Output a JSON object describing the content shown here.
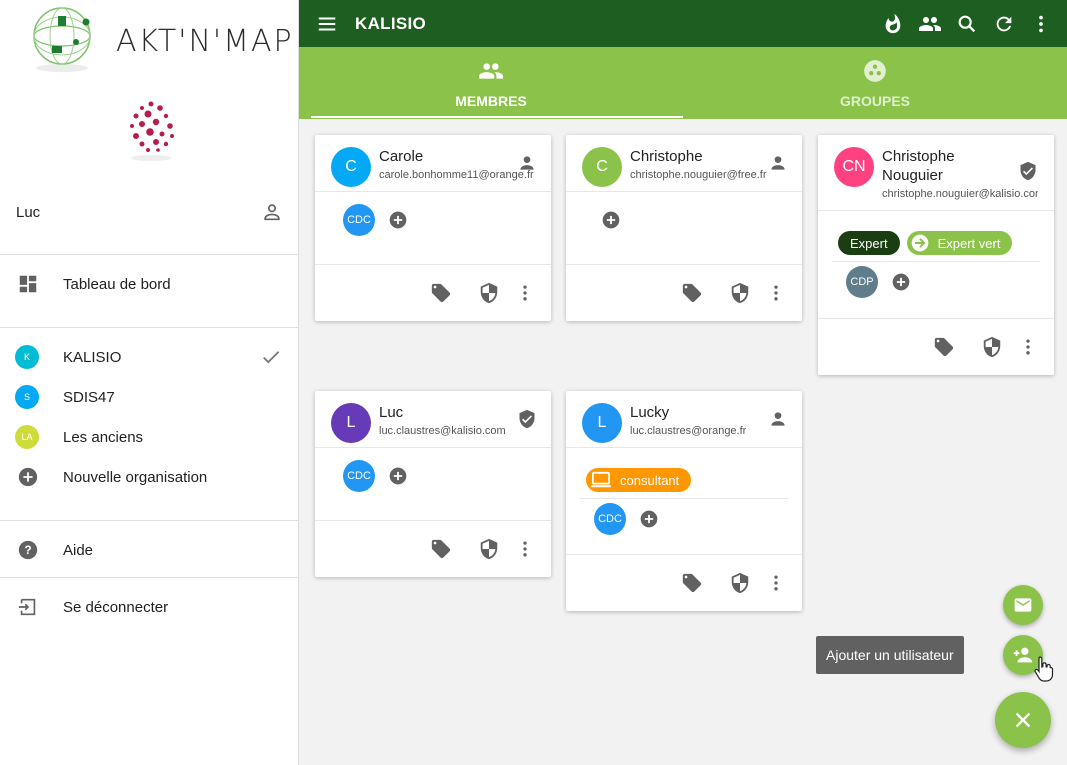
{
  "sidebar": {
    "app_name": "AKT'N'MAP",
    "user_name": "Luc",
    "dashboard_label": "Tableau de bord",
    "organisations": [
      {
        "label": "KALISIO",
        "initials": "K",
        "color": "#00bcd4",
        "selected": true
      },
      {
        "label": "SDIS47",
        "initials": "S",
        "color": "#03a9f4",
        "selected": false
      },
      {
        "label": "Les anciens",
        "initials": "LA",
        "color": "#cddc39",
        "selected": false
      }
    ],
    "new_org_label": "Nouvelle organisation",
    "help_label": "Aide",
    "logout_label": "Se déconnecter"
  },
  "topbar": {
    "title": "KALISIO",
    "icons": [
      "fire-icon",
      "people-icon",
      "search-icon",
      "refresh-icon",
      "more-vert-icon"
    ]
  },
  "tabs": [
    {
      "label": "MEMBRES",
      "icon": "people-icon",
      "active": true
    },
    {
      "label": "GROUPES",
      "icon": "bubbles-icon",
      "active": false
    }
  ],
  "members": [
    {
      "initials": "C",
      "name": "Carole",
      "email": "carole.bonhomme11@orange.fr",
      "color": "#03a9f4",
      "role": "member",
      "tags": [],
      "groups": [
        {
          "label": "CDC",
          "color": "#2196f3"
        }
      ]
    },
    {
      "initials": "C",
      "name": "Christophe",
      "email": "christophe.nouguier@free.fr",
      "color": "#8bc34a",
      "role": "member",
      "tags": [],
      "groups": []
    },
    {
      "initials": "CN",
      "name": "Christophe Nouguier",
      "email": "christophe.nouguier@kalisio.com",
      "color": "#ff4081",
      "role": "manager",
      "tags": [
        {
          "label": "Expert",
          "color": "#1b3d12"
        },
        {
          "label": "Expert vert",
          "color": "#8bc34a"
        }
      ],
      "groups": [
        {
          "label": "CDP",
          "color": "#607d8b"
        }
      ]
    },
    {
      "initials": "L",
      "name": "Luc",
      "email": "luc.claustres@kalisio.com",
      "color": "#673ab7",
      "role": "manager",
      "tags": [],
      "groups": [
        {
          "label": "CDC",
          "color": "#2196f3"
        }
      ]
    },
    {
      "initials": "L",
      "name": "Lucky",
      "email": "luc.claustres@orange.fr",
      "color": "#2196f3",
      "role": "member",
      "tags": [
        {
          "label": "consultant",
          "color": "#ff9800"
        }
      ],
      "groups": [
        {
          "label": "CDC",
          "color": "#2196f3"
        }
      ]
    }
  ],
  "fab": {
    "tooltip": "Ajouter un utilisateur"
  }
}
